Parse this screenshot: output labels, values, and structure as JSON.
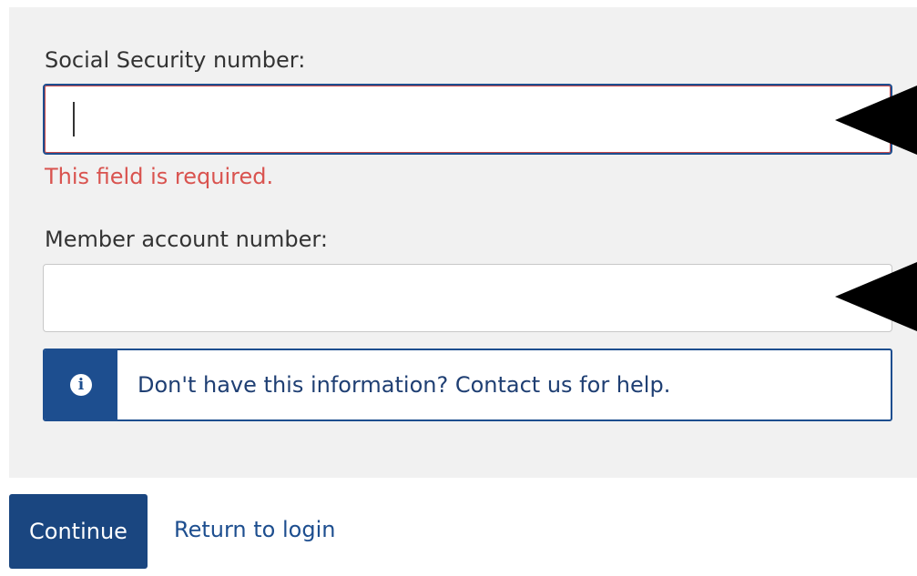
{
  "form": {
    "ssn_label": "Social Security number:",
    "ssn_value": "",
    "ssn_error": "This field is required.",
    "member_label": "Member account number:",
    "member_value": ""
  },
  "info": {
    "icon": "info-icon",
    "icon_glyph": "i",
    "text": "Don't have this information? Contact us for help."
  },
  "actions": {
    "continue_label": "Continue",
    "return_label": "Return to login"
  },
  "colors": {
    "panel_bg": "#f1f1f1",
    "primary": "#1d4e8f",
    "error": "#d9534f",
    "annotation": "#000000"
  }
}
